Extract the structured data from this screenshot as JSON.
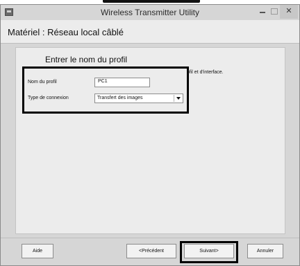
{
  "window": {
    "title": "Wireless Transmitter Utility"
  },
  "header": {
    "title": "Matériel : Réseau local câblé"
  },
  "panel": {
    "title": "Entrer le nom du profil",
    "description": "Entrez un nom pour le nouveau profil et sélectionnez le type de profil et d'interface."
  },
  "form": {
    "profile_name_label": "Nom du profil",
    "profile_name_value": "PC1",
    "connection_type_label": "Type de connexion",
    "connection_type_value": "Transfert des images"
  },
  "buttons": {
    "help": "Aide",
    "previous": "<Précédent",
    "next": "Suivant>",
    "cancel": "Annuler"
  },
  "icons": {
    "app": "app-icon",
    "minimize": "minimize-icon",
    "maximize": "maximize-icon",
    "close": "close-icon",
    "dropdown": "chevron-down-icon"
  }
}
